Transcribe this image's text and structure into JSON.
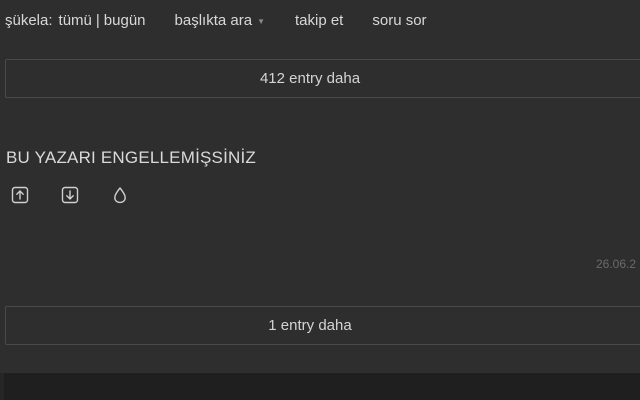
{
  "topbar": {
    "sukela_label": "şükela:",
    "sukela_all": "tümü",
    "sukela_sep": "|",
    "sukela_today": "bugün",
    "search_in_title": "başlıkta ara",
    "follow": "takip et",
    "ask_question": "soru sor"
  },
  "more_entries_top": {
    "label": "412 entry daha"
  },
  "blocked_author": {
    "text": "BU YAZARI ENGELLEMİŞSİNİZ"
  },
  "entry_actions": {
    "upvote_icon": "arrow-up-square-icon",
    "downvote_icon": "arrow-down-square-icon",
    "drop_icon": "drop-icon"
  },
  "entry_date": {
    "text": "26.06.2"
  },
  "more_entries_bottom": {
    "label": "1 entry daha"
  }
}
